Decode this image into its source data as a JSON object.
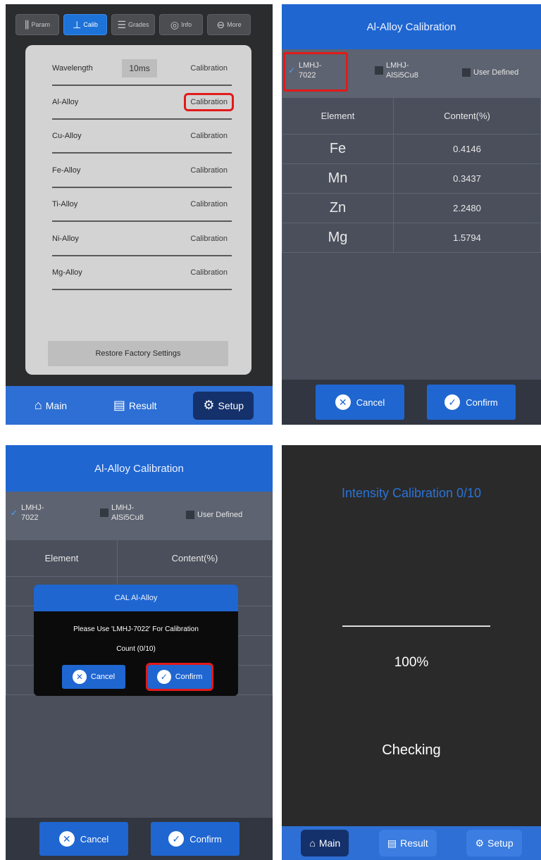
{
  "screen1": {
    "tabs": [
      {
        "icon": "sliders-icon",
        "glyph": "⫼",
        "label": "Param"
      },
      {
        "icon": "calibration-icon",
        "glyph": "⊥",
        "label": "Calib"
      },
      {
        "icon": "grades-icon",
        "glyph": "☰",
        "label": "Grades"
      },
      {
        "icon": "info-icon",
        "glyph": "◎",
        "label": "Info"
      },
      {
        "icon": "more-icon",
        "glyph": "⊖",
        "label": "More"
      }
    ],
    "wavelength": {
      "label": "Wavelength",
      "value": "10ms",
      "action": "Calibration"
    },
    "rows": [
      {
        "label": "Al-Alloy",
        "action": "Calibration"
      },
      {
        "label": "Cu-Alloy",
        "action": "Calibration"
      },
      {
        "label": "Fe-Alloy",
        "action": "Calibration"
      },
      {
        "label": "Ti-Alloy",
        "action": "Calibration"
      },
      {
        "label": "Ni-Alloy",
        "action": "Calibration"
      },
      {
        "label": "Mg-Alloy",
        "action": "Calibration"
      }
    ],
    "restore_label": "Restore Factory Settings",
    "nav": {
      "main": "Main",
      "result": "Result",
      "setup": "Setup"
    }
  },
  "calib": {
    "title": "Al-Alloy Calibration",
    "opt1_line1": "LMHJ-",
    "opt1_line2": "7022",
    "opt2_line1": "LMHJ-",
    "opt2_line2": "AlSi5Cu8",
    "opt3": "User Defined",
    "col_element": "Element",
    "col_content": "Content(%)",
    "rows": [
      {
        "element": "Fe",
        "content": "0.4146"
      },
      {
        "element": "Mn",
        "content": "0.3437"
      },
      {
        "element": "Zn",
        "content": "2.2480"
      },
      {
        "element": "Mg",
        "content": "1.5794"
      }
    ],
    "cancel": "Cancel",
    "confirm": "Confirm"
  },
  "dialog": {
    "title": "CAL Al-Alloy",
    "message": "Please Use 'LMHJ-7022' For Calibration",
    "count": "Count (0/10)",
    "cancel": "Cancel",
    "confirm": "Confirm"
  },
  "screen4": {
    "title": "Intensity Calibration 0/10",
    "percent": "100%",
    "progress": 1.0,
    "status": "Checking",
    "nav": {
      "main": "Main",
      "result": "Result",
      "setup": "Setup"
    }
  }
}
